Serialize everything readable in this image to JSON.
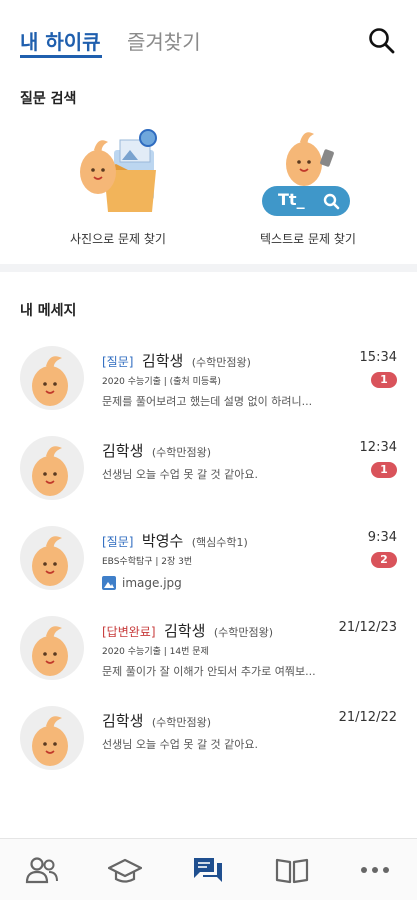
{
  "header": {
    "tabs": [
      {
        "label": "내 하이큐",
        "active": true
      },
      {
        "label": "즐겨찾기",
        "active": false
      }
    ]
  },
  "question_search": {
    "title": "질문 검색",
    "photo_label": "사진으로 문제 찾기",
    "text_label": "텍스트로 문제 찾기",
    "text_badge": "Tt_"
  },
  "messages_section": {
    "title": "내 메세지",
    "items": [
      {
        "tag": "[질문]",
        "name": "김학생",
        "subject": "(수학만점왕)",
        "time": "15:34",
        "meta": "2020 수능기출 | (출처 미등록)",
        "preview": "문제를 풀어보려고 했는데 설명 없이 하려니...",
        "badge": "1"
      },
      {
        "tag": "",
        "name": "김학생",
        "subject": "(수학만점왕)",
        "time": "12:34",
        "meta": "",
        "preview": "선생님 오늘 수업 못 갈 것 같아요.",
        "badge": "1"
      },
      {
        "tag": "[질문]",
        "name": "박영수",
        "subject": "(핵심수학1)",
        "time": "9:34",
        "meta": "EBS수학탐구 | 2장 3번",
        "attachment": "image.jpg",
        "badge": "2"
      },
      {
        "tag": "[답변완료]",
        "name": "김학생",
        "subject": "(수학만점왕)",
        "time": "21/12/23",
        "meta": "2020 수능기출 | 14번 문제",
        "preview": "문제 풀이가 잘 이해가 안되서 추가로 여쭤보...",
        "badge": ""
      },
      {
        "tag": "",
        "name": "김학생",
        "subject": "(수학만점왕)",
        "time": "21/12/22",
        "meta": "",
        "preview": "선생님 오늘 수업 못 갈 것 같아요.",
        "badge": ""
      }
    ]
  },
  "bottom_nav": {
    "items": [
      {
        "icon": "people-icon"
      },
      {
        "icon": "graduation-cap-icon"
      },
      {
        "icon": "chat-icon",
        "active": true
      },
      {
        "icon": "book-icon"
      },
      {
        "icon": "more-icon"
      }
    ]
  },
  "colors": {
    "accent": "#1f5fae",
    "badge": "#d9535b",
    "tag_question": "#2f6cc0",
    "tag_done": "#c73b3b",
    "mascot": "#f5b777"
  }
}
